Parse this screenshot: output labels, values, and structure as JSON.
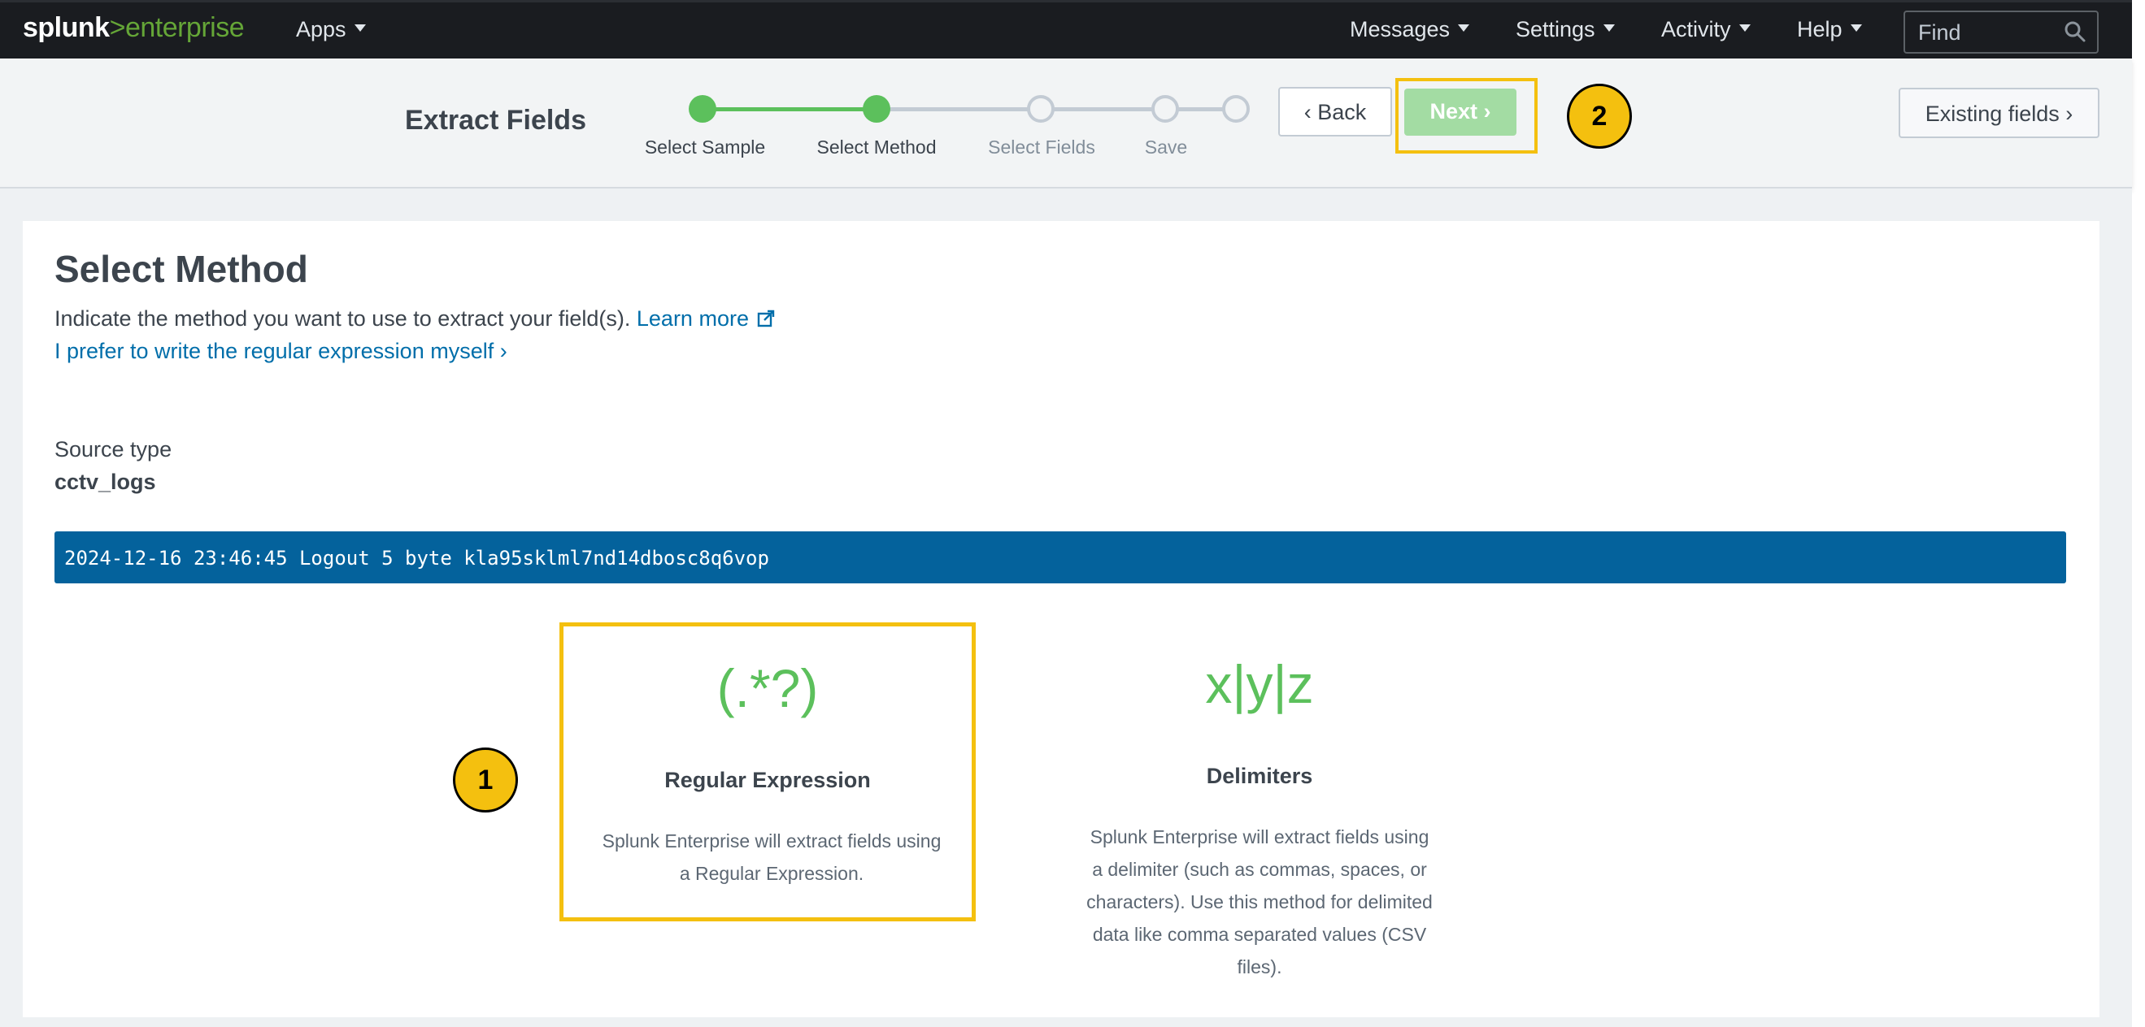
{
  "topnav": {
    "logo_brand": "splunk",
    "logo_gt": ">",
    "logo_product": "enterprise",
    "apps": "Apps",
    "messages": "Messages",
    "settings": "Settings",
    "activity": "Activity",
    "help": "Help",
    "find_placeholder": "Find"
  },
  "wizard": {
    "title": "Extract Fields",
    "steps": [
      {
        "label": "Select Sample",
        "state": "done"
      },
      {
        "label": "Select Method",
        "state": "current"
      },
      {
        "label": "Select Fields",
        "state": "todo"
      },
      {
        "label": "Save",
        "state": "todo"
      }
    ],
    "back_label": "Back",
    "next_label": "Next",
    "existing_fields_label": "Existing fields"
  },
  "main": {
    "heading": "Select Method",
    "description": "Indicate the method you want to use to extract your field(s).",
    "learn_more": "Learn more",
    "regex_link": "I prefer to write the regular expression myself",
    "source_type_label": "Source type",
    "source_type_value": "cctv_logs",
    "sample_event": "2024-12-16 23:46:45 Logout 5 byte kla95sklml7nd14dbosc8q6vop",
    "methods": [
      {
        "icon": "(.*?)",
        "title": "Regular Expression",
        "description": "Splunk Enterprise will extract fields using a Regular Expression."
      },
      {
        "icon": "x|y|z",
        "title": "Delimiters",
        "description": "Splunk Enterprise will extract fields using a delimiter (such as commas, spaces, or characters). Use this method for delimited data like comma separated values (CSV files)."
      }
    ]
  },
  "annotations": {
    "badge_1": "1",
    "badge_2": "2"
  },
  "colors": {
    "topbar": "#1a1c20",
    "accent_green": "#5cc05c",
    "link_blue": "#006eaa",
    "sample_bg": "#04629c",
    "highlight": "#f4c00f"
  }
}
